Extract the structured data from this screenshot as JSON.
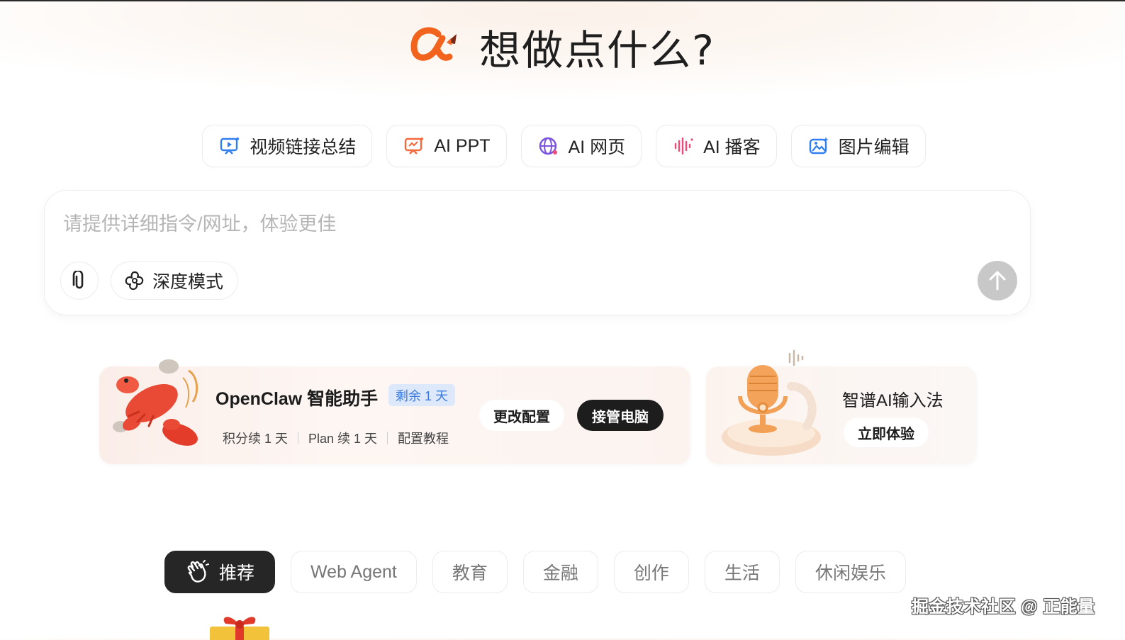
{
  "header": {
    "headline": "想做点什么?",
    "logo_name": "alpha-logo"
  },
  "quick_chips": [
    {
      "label": "视频链接总结",
      "icon": "video-summary-icon",
      "color": "#2f7ff0"
    },
    {
      "label": "AI PPT",
      "icon": "ppt-icon",
      "color": "#f26a3d"
    },
    {
      "label": "AI 网页",
      "icon": "globe-icon",
      "color": "#7a54e0"
    },
    {
      "label": "AI 播客",
      "icon": "audio-wave-icon",
      "color": "#ef4b7c"
    },
    {
      "label": "图片编辑",
      "icon": "image-edit-icon",
      "color": "#2f7ff0"
    }
  ],
  "input": {
    "placeholder": "请提供详细指令/网址，体验更佳",
    "value": "",
    "deep_mode_label": "深度模式"
  },
  "promo_openclaw": {
    "title": "OpenClaw 智能助手",
    "badge": "剩余 1 天",
    "meta": [
      "积分续 1 天",
      "Plan 续 1 天",
      "配置教程"
    ],
    "config_button": "更改配置",
    "takeover_button": "接管电脑"
  },
  "promo_input_method": {
    "title": "智谱AI输入法",
    "try_button": "立即体验"
  },
  "category_tabs": [
    {
      "label": "推荐",
      "active": true
    },
    {
      "label": "Web Agent",
      "active": false
    },
    {
      "label": "教育",
      "active": false
    },
    {
      "label": "金融",
      "active": false
    },
    {
      "label": "创作",
      "active": false
    },
    {
      "label": "生活",
      "active": false
    },
    {
      "label": "休闲娱乐",
      "active": false
    }
  ],
  "watermark": "掘金技术社区 @ 正能量",
  "colors": {
    "accent": "#f2641e",
    "dark_button": "#1d1d1d",
    "send_disabled": "#c8c8c8",
    "badge_bg": "#dde9fb",
    "badge_text": "#3a78e0"
  }
}
